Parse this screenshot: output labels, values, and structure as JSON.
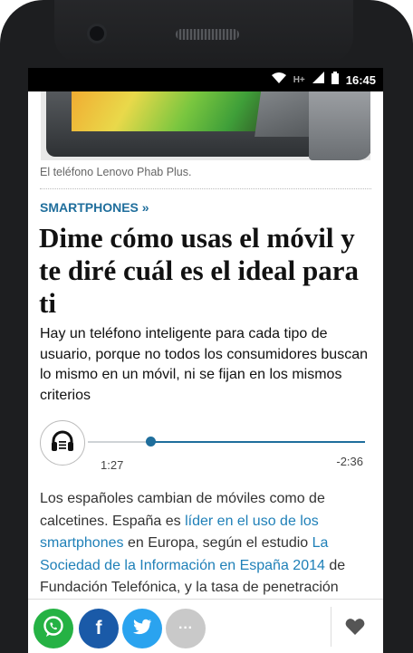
{
  "status_bar": {
    "network": "H+",
    "time": "16:45"
  },
  "article": {
    "image_caption": "El teléfono Lenovo Phab Plus.",
    "section": "SMARTPHONES »",
    "headline": "Dime cómo usas el móvil y te diré cuál es el ideal para ti",
    "subhead": "Hay un teléfono inteligente para cada tipo de usuario, porque no todos los consumidores buscan lo mismo en un móvil, ni se fijan en los mismos criterios",
    "body_part1": "Los españoles cambian de móviles como de calcetines. España es ",
    "body_link1": "líder en el uso de los smartphones",
    "body_part2": " en Europa, según el estudio ",
    "body_link2": "La Sociedad de la Información en España 2014",
    "body_part3": " de Fundación Telefónica, y la tasa de penetración"
  },
  "audio_player": {
    "elapsed": "1:27",
    "remaining": "-2:36",
    "progress_fraction": 0.25,
    "icon": "headphones-icon"
  },
  "share_bar": {
    "buttons": [
      {
        "name": "whatsapp",
        "color": "#25b244"
      },
      {
        "name": "facebook",
        "color": "#1a5aa8"
      },
      {
        "name": "twitter",
        "color": "#2aa3ef"
      },
      {
        "name": "more",
        "color": "#c9c9c9"
      }
    ],
    "facebook_glyph": "f",
    "more_glyph": "···",
    "favorite_icon": "heart-icon"
  },
  "colors": {
    "accent": "#1f6e9c",
    "link": "#1f80b8"
  }
}
